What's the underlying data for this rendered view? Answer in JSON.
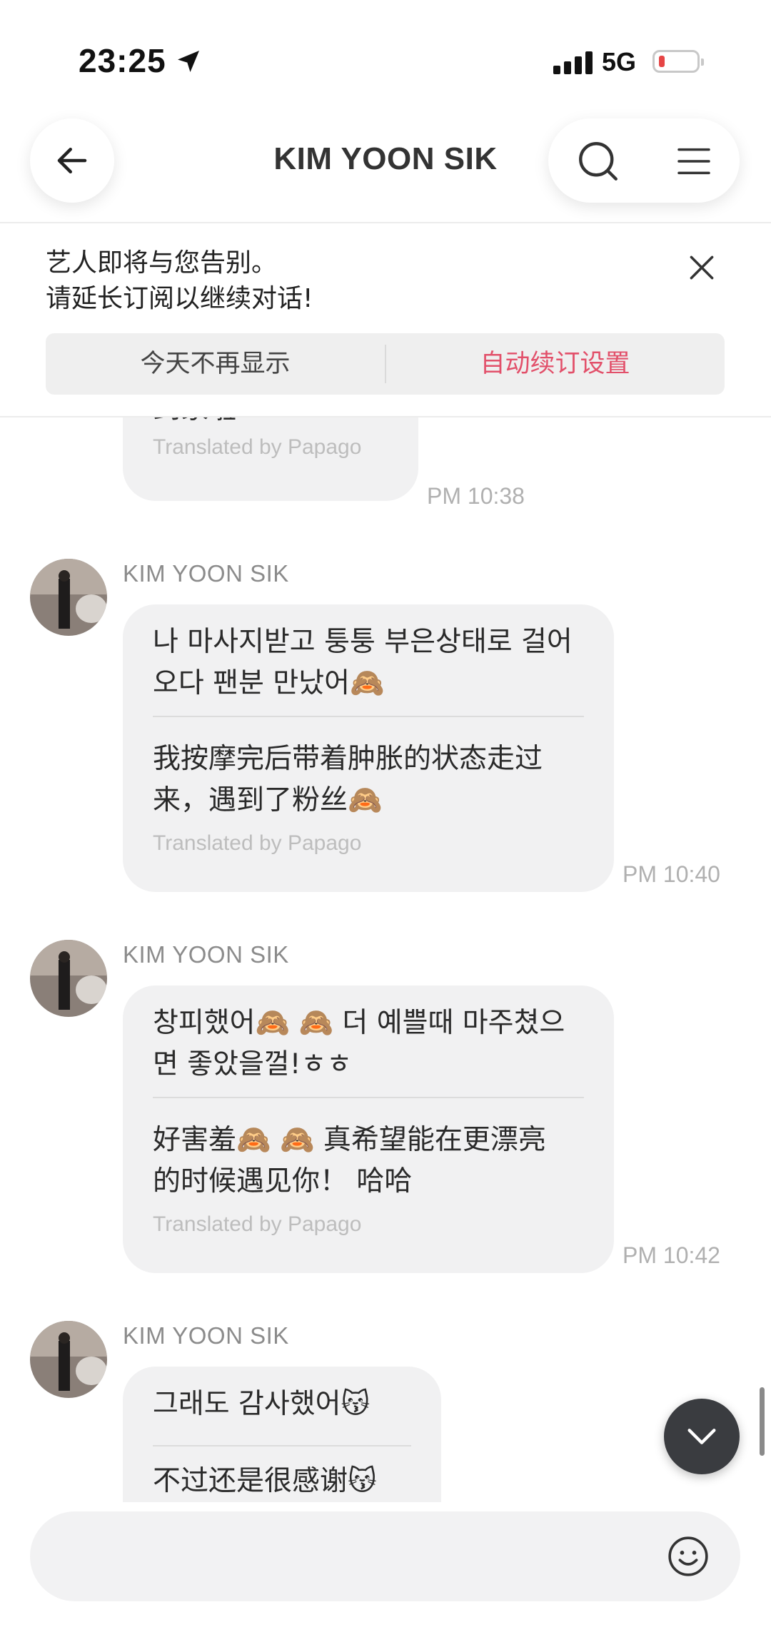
{
  "status_bar": {
    "time": "23:25",
    "network": "5G"
  },
  "header": {
    "title": "KIM YOON SIK"
  },
  "notice": {
    "line1": "艺人即将与您告别。",
    "line2": "请延长订阅以继续对话!",
    "dismiss_label": "今天不再显示",
    "renew_label": "自动续订设置"
  },
  "messages": [
    {
      "text_lines": [
        "到家啦~~~"
      ],
      "translated_by": "Translated by Papago",
      "time": "PM 10:38"
    },
    {
      "sender": "KIM YOON SIK",
      "original_lines": [
        "나 마사지받고 퉁퉁 부은상태로 걸어",
        "오다 팬분 만났어🙈"
      ],
      "translated_lines": [
        "我按摩完后带着肿胀的状态走过",
        "来，遇到了粉丝🙈"
      ],
      "translated_by": "Translated by Papago",
      "time": "PM 10:40"
    },
    {
      "sender": "KIM YOON SIK",
      "original_lines": [
        "창피했어🙈 🙈 더 예쁠때 마주쳤으",
        "면 좋았을껄!ㅎㅎ"
      ],
      "translated_lines": [
        "好害羞🙈 🙈 真希望能在更漂亮",
        "的时候遇见你！ 哈哈"
      ],
      "translated_by": "Translated by Papago",
      "time": "PM 10:42"
    },
    {
      "sender": "KIM YOON SIK",
      "original_lines": [
        "그래도 감사했어😽"
      ],
      "translated_lines": [
        "不过还是很感谢😽"
      ]
    }
  ],
  "input": {
    "placeholder": ""
  },
  "colors": {
    "accent": "#e2506a",
    "bubble": "#f1f1f2",
    "scroll_button": "#3a3c40"
  },
  "icons": [
    "location-arrow-icon",
    "back-arrow-icon",
    "search-icon",
    "menu-icon",
    "close-icon",
    "chevron-down-icon",
    "emoji-icon"
  ]
}
